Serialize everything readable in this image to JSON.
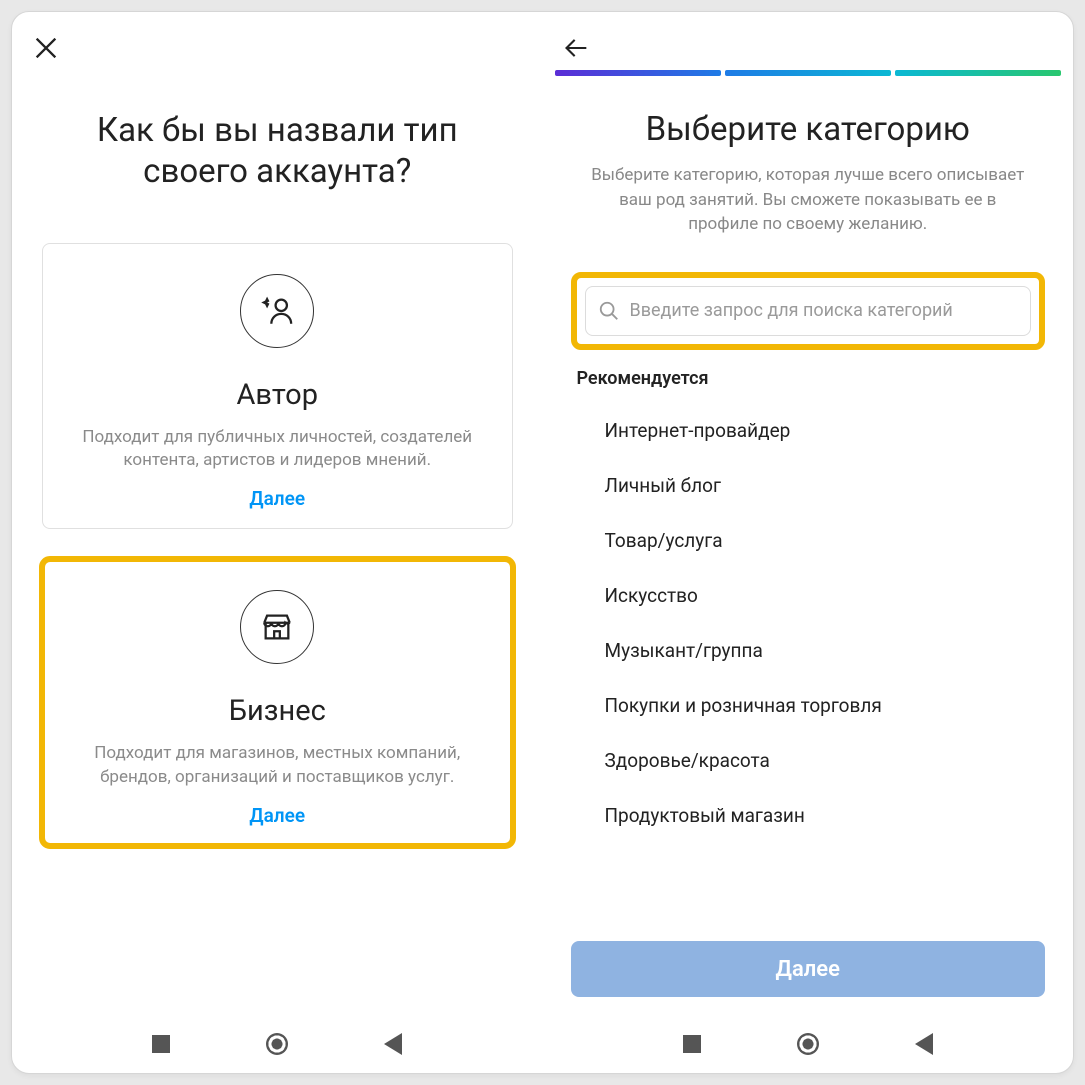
{
  "left": {
    "title": "Как бы вы назвали тип своего аккаунта?",
    "cards": [
      {
        "title": "Автор",
        "desc": "Подходит для публичных личностей, создателей контента, артистов и лидеров мнений.",
        "link": "Далее"
      },
      {
        "title": "Бизнес",
        "desc": "Подходит для магазинов, местных компаний, брендов, организаций и поставщиков услуг.",
        "link": "Далее"
      }
    ]
  },
  "right": {
    "title": "Выберите категорию",
    "subtitle": "Выберите категорию, которая лучше всего описывает ваш род занятий. Вы сможете показывать ее в профиле по своему желанию.",
    "search_placeholder": "Введите запрос для поиска категорий",
    "recommend_label": "Рекомендуется",
    "categories": [
      "Интернет-провайдер",
      "Личный блог",
      "Товар/услуга",
      "Искусство",
      "Музыкант/группа",
      "Покупки и розничная торговля",
      "Здоровье/красота",
      "Продуктовый магазин"
    ],
    "next_label": "Далее"
  },
  "colors": {
    "highlight": "#f2b705",
    "link": "#0095F6",
    "next_button": "#8FB3E1"
  }
}
